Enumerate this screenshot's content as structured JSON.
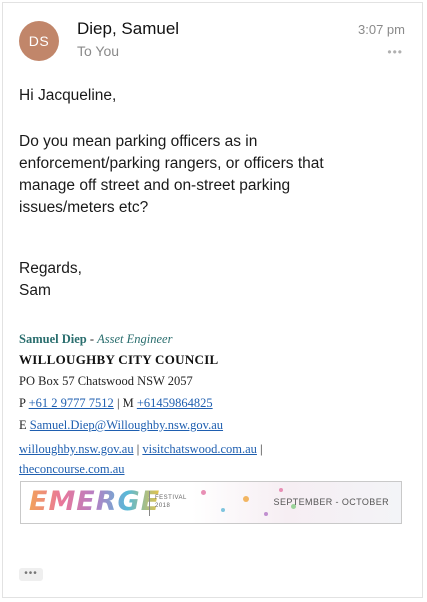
{
  "header": {
    "avatar_initials": "DS",
    "avatar_color": "#c1866a",
    "sender": "Diep, Samuel",
    "recipient": "To You",
    "time": "3:07 pm",
    "more_label": "•••"
  },
  "message": {
    "greeting": "Hi Jacqueline,",
    "question": "Do you mean parking officers as in enforcement/parking rangers, or officers that manage off street and on-street parking issues/meters etc?",
    "regards": "Regards,",
    "name": "Sam"
  },
  "signature": {
    "name": "Samuel Diep",
    "separator": " - ",
    "role": "Asset Engineer",
    "organization": "WILLOUGHBY CITY COUNCIL",
    "po_box": "PO Box 57 Chatswood NSW 2057",
    "phone_prefix": "P ",
    "phone": "+61 2 9777 7512",
    "mobile_sep": " | M ",
    "mobile": "+61459864825",
    "email_prefix": "E ",
    "email": "Samuel.Diep@Willoughby.nsw.gov.au",
    "link_council": "willoughby.nsw.gov.au",
    "link_sep": " | ",
    "link_visit": "visitchatswood.com.au",
    "link_sep2": " |",
    "link_concourse": "theconcourse.com.au"
  },
  "banner": {
    "logo": "EMERGE",
    "festival_line1": "FESTIVAL",
    "festival_line2": "2018",
    "dates": "SEPTEMBER - OCTOBER"
  },
  "footer": {
    "more_label": "•••"
  },
  "colors": {
    "link": "#1f5fb0",
    "signature_accent": "#2a6e6e"
  }
}
